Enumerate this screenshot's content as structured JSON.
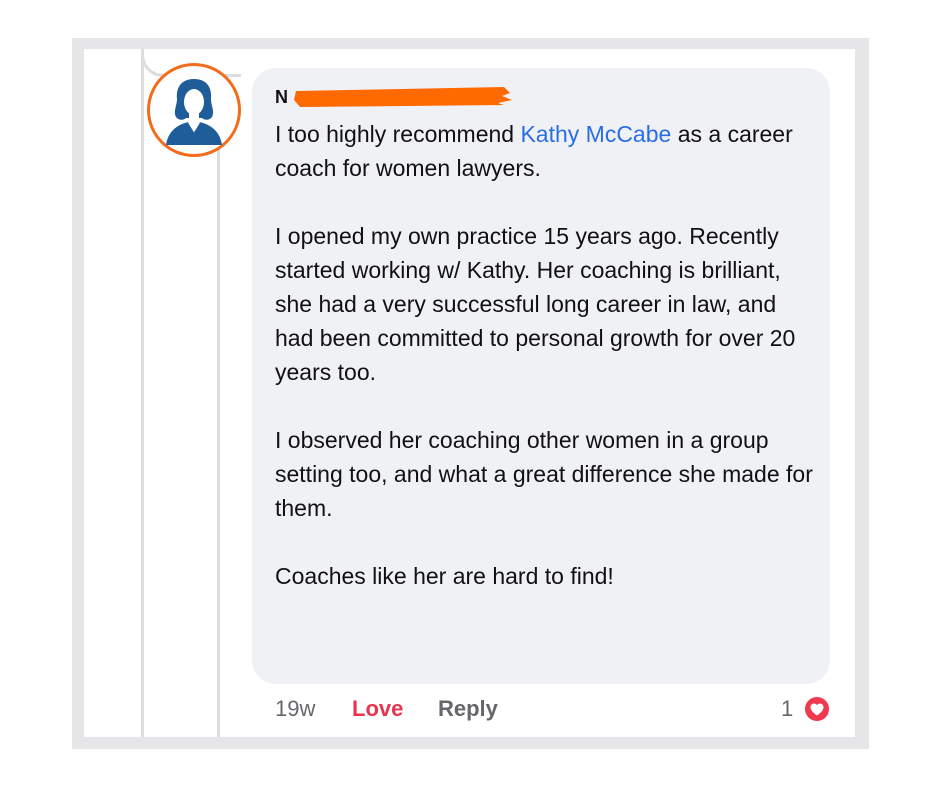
{
  "comment": {
    "author_initial": "N",
    "body_prefix": "I too highly recommend ",
    "mention": "Kathy McCabe",
    "body_suffix": " as a career coach for women lawyers.",
    "paragraph_2": "I opened my own practice 15 years ago. Recently started working w/ Kathy. Her coaching is brilliant, she had a very successful long career in law, and had been committed to personal growth for over 20 years too.",
    "paragraph_3": "I observed her coaching other women in a group setting too, and what a great difference she made for them.",
    "paragraph_4": "Coaches like her are hard to find!"
  },
  "actions": {
    "time": "19w",
    "love": "Love",
    "reply": "Reply"
  },
  "reactions": {
    "count": "1",
    "icon": "heart-icon"
  },
  "avatar": {
    "icon": "user-silhouette-icon"
  },
  "colors": {
    "mention": "#2a6ee6",
    "love": "#e8344f",
    "avatar_ring": "#f26c1c",
    "avatar_figure": "#1f5c9a",
    "redaction": "#ff6a00",
    "bubble": "#f0f1f4"
  }
}
